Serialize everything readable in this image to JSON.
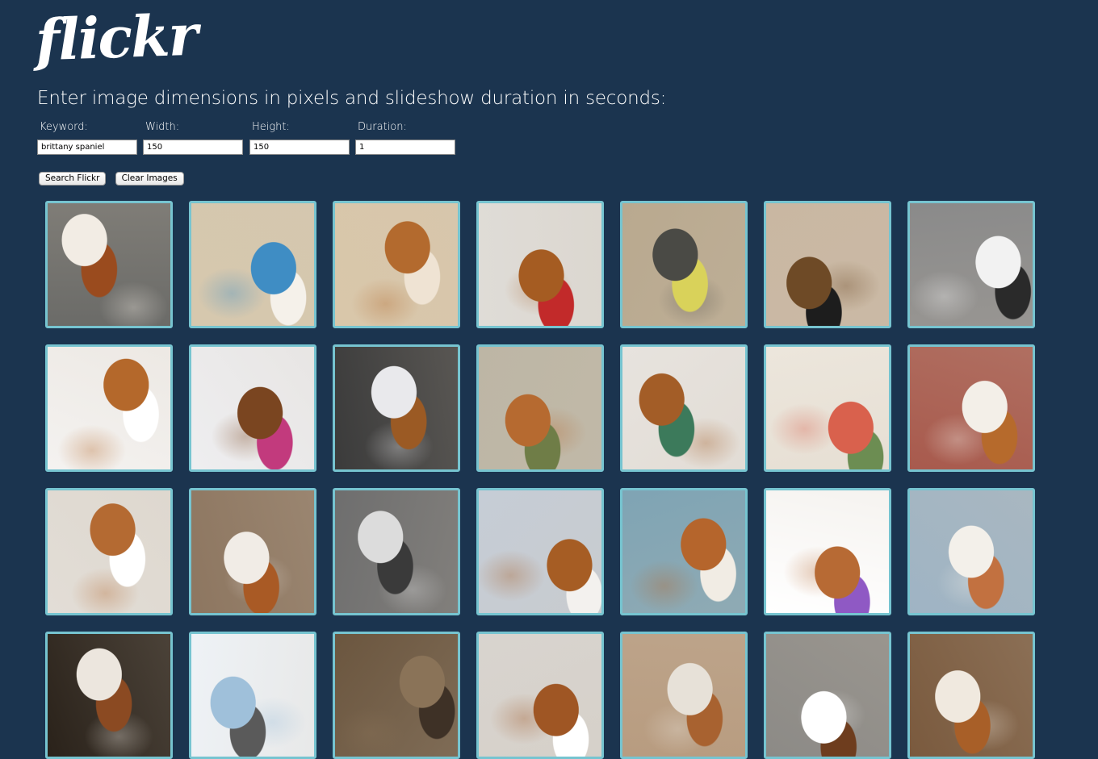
{
  "logo": "flickr",
  "instructions": "Enter image dimensions in pixels and slideshow duration in seconds:",
  "form": {
    "keyword": {
      "label": "Keyword:",
      "value": "brittany spaniel"
    },
    "width": {
      "label": "Width:",
      "value": "150"
    },
    "height": {
      "label": "Height:",
      "value": "150"
    },
    "duration": {
      "label": "Duration:",
      "value": "1"
    }
  },
  "buttons": {
    "search": "Search Flickr",
    "clear": "Clear Images"
  },
  "colors": {
    "background": "#1b344f",
    "tile_border": "#76c4d0"
  },
  "photos": [
    {
      "name": "dog-standing-gravel",
      "bg": "#6b6b68",
      "fg": "#f2ece4",
      "accent": "#9a4b1e"
    },
    {
      "name": "dog-on-beach",
      "bg": "#d6c8ae",
      "fg": "#3f8dc4",
      "accent": "#f5f1ea"
    },
    {
      "name": "dog-face-closeup",
      "bg": "#d9c7aa",
      "fg": "#b36a2e",
      "accent": "#efe3d3"
    },
    {
      "name": "dog-red-collar-snow",
      "bg": "#dfdcd7",
      "fg": "#a55c22",
      "accent": "#c22a2a"
    },
    {
      "name": "dogs-with-person",
      "bg": "#b9a98f",
      "fg": "#4a4a45",
      "accent": "#d9d25a"
    },
    {
      "name": "puppies-kitchen",
      "bg": "#c9b7a2",
      "fg": "#6e4a26",
      "accent": "#1d1d1d"
    },
    {
      "name": "dog-black-white",
      "bg": "#8a8a8a",
      "fg": "#f2f2f2",
      "accent": "#2a2a2a"
    },
    {
      "name": "dogs-white-background",
      "bg": "#f4f2f0",
      "fg": "#b4682b",
      "accent": "#ffffff"
    },
    {
      "name": "dog-pink-collar-snow",
      "bg": "#eeeef0",
      "fg": "#7a4520",
      "accent": "#c23a7d"
    },
    {
      "name": "dog-snow-path",
      "bg": "#3b3b3b",
      "fg": "#e9e9ec",
      "accent": "#9b5a24"
    },
    {
      "name": "dog-beach-grass",
      "bg": "#bdb6a5",
      "fg": "#b66a30",
      "accent": "#6f7d47"
    },
    {
      "name": "dog-face-snow",
      "bg": "#e7e3de",
      "fg": "#a35d27",
      "accent": "#3c7a5b"
    },
    {
      "name": "heart-wall",
      "bg": "#ece6dc",
      "fg": "#d9614d",
      "accent": "#6c8d52"
    },
    {
      "name": "dog-sitting-bricks",
      "bg": "#a85a4d",
      "fg": "#f3efe8",
      "accent": "#b66a2c"
    },
    {
      "name": "dog-sleeping",
      "bg": "#e2ddd6",
      "fg": "#b46a32",
      "accent": "#ffffff"
    },
    {
      "name": "dog-portrait-collar",
      "bg": "#8d7660",
      "fg": "#f1ece6",
      "accent": "#a95a25"
    },
    {
      "name": "dog-grayscale-smile",
      "bg": "#6e6e6e",
      "fg": "#dcdcdc",
      "accent": "#3a3a3a"
    },
    {
      "name": "dog-looking-up",
      "bg": "#c6cdd6",
      "fg": "#a65d24",
      "accent": "#f3f1ee"
    },
    {
      "name": "dog-profile-blue",
      "bg": "#7fa4b4",
      "fg": "#b5652c",
      "accent": "#f1ece4"
    },
    {
      "name": "dog-cartoon",
      "bg": "#ffffff",
      "fg": "#b76a34",
      "accent": "#8f59c4"
    },
    {
      "name": "dog-nose-snow",
      "bg": "#9fb4c4",
      "fg": "#f3f0ea",
      "accent": "#c27140"
    },
    {
      "name": "dog-dark-portrait",
      "bg": "#2a221a",
      "fg": "#ece6de",
      "accent": "#8b4a22"
    },
    {
      "name": "snowy-field",
      "bg": "#eef2f6",
      "fg": "#9fc0da",
      "accent": "#5a5a5a"
    },
    {
      "name": "paw-prints-dirt",
      "bg": "#6b563f",
      "fg": "#8a7358",
      "accent": "#3e3126"
    },
    {
      "name": "dog-lying-closeup",
      "bg": "#d8d4cf",
      "fg": "#9f5624",
      "accent": "#ffffff"
    },
    {
      "name": "dog-face-warm",
      "bg": "#b89c80",
      "fg": "#e7e1d8",
      "accent": "#a86230"
    },
    {
      "name": "dog-on-pavement",
      "bg": "#8c8a86",
      "fg": "#ffffff",
      "accent": "#6e3d1e"
    },
    {
      "name": "dog-in-yard",
      "bg": "#7a5a3e",
      "fg": "#f0e9df",
      "accent": "#a85f28"
    }
  ]
}
